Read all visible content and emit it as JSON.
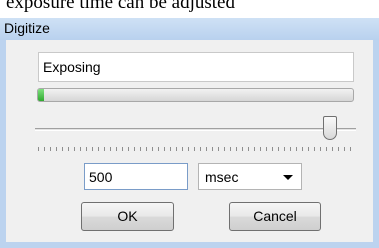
{
  "background": {
    "partial_text": "exposure time can be adjusted"
  },
  "window": {
    "title": "Digitize"
  },
  "status": {
    "text": "Exposing"
  },
  "progress": {
    "fraction": 0.02,
    "color": "#2faa2f"
  },
  "slider": {
    "fraction": 0.92
  },
  "exposure": {
    "value": "500",
    "unit": "msec"
  },
  "buttons": {
    "ok": "OK",
    "cancel": "Cancel"
  },
  "colors": {
    "titlebar": "#bcd3ef",
    "client": "#f0f0f0"
  }
}
